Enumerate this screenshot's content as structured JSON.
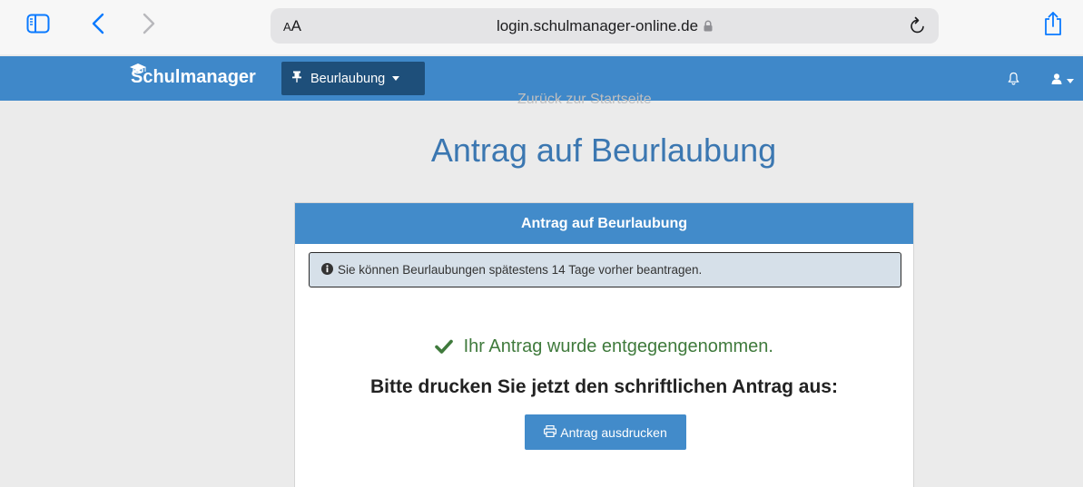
{
  "browser": {
    "text_size_label_small": "A",
    "text_size_label_large": "A",
    "url": "login.schulmanager-online.de"
  },
  "navbar": {
    "brand": "Schulmanager",
    "dropdown_label": "Beurlaubung",
    "colors": {
      "bar": "#3f88c9",
      "dropdown": "#1e4f7a"
    }
  },
  "page": {
    "back_link": "Zurück zur Startseite",
    "title": "Antrag auf Beurlaubung"
  },
  "panel": {
    "header": "Antrag auf Beurlaubung",
    "info_message": "Sie können Beurlaubungen spätestens 14 Tage vorher beantragen.",
    "success_message": "Ihr Antrag wurde entgegengenommen.",
    "instruction": "Bitte drucken Sie jetzt den schriftlichen Antrag aus:",
    "print_button": "Antrag ausdrucken"
  },
  "icons": [
    "sidebar-icon",
    "back-arrow-icon",
    "forward-arrow-icon",
    "lock-icon",
    "reload-icon",
    "share-icon",
    "graduation-cap-icon",
    "pin-icon",
    "bell-icon",
    "user-icon",
    "info-circle-icon",
    "checkmark-icon",
    "printer-icon"
  ]
}
